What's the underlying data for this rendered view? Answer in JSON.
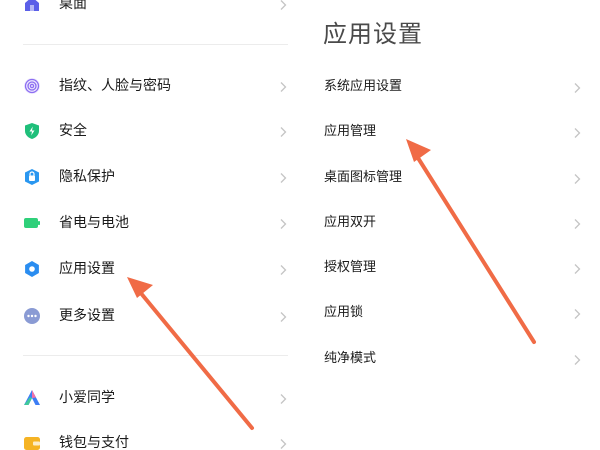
{
  "colors": {
    "arrow": "#f06b46",
    "text": "#1a1a1a",
    "title": "#4a4a4a",
    "chevron": "#c4c4c4",
    "divider": "#ececec"
  },
  "left_list": {
    "items": [
      {
        "label": "桌面",
        "icon": "home-icon",
        "color": "#5b5fe8"
      },
      {
        "label": "指纹、人脸与密码",
        "icon": "fingerprint-icon",
        "color": "#8c6ef2"
      },
      {
        "label": "安全",
        "icon": "shield-icon",
        "color": "#1fbf7a"
      },
      {
        "label": "隐私保护",
        "icon": "privacy-icon",
        "color": "#2a97f0"
      },
      {
        "label": "省电与电池",
        "icon": "battery-icon",
        "color": "#2fd07a"
      },
      {
        "label": "应用设置",
        "icon": "gear-icon",
        "color": "#2a8df0"
      },
      {
        "label": "更多设置",
        "icon": "more-icon",
        "color": "#8a9bd4"
      },
      {
        "label": "小爱同学",
        "icon": "xiaoai-icon",
        "color": "#3d7ef5"
      },
      {
        "label": "钱包与支付",
        "icon": "wallet-icon",
        "color": "#f5b324"
      }
    ]
  },
  "right_panel": {
    "title": "应用设置",
    "items": [
      {
        "label": "系统应用设置"
      },
      {
        "label": "应用管理"
      },
      {
        "label": "桌面图标管理"
      },
      {
        "label": "应用双开"
      },
      {
        "label": "授权管理"
      },
      {
        "label": "应用锁"
      },
      {
        "label": "纯净模式"
      }
    ]
  }
}
